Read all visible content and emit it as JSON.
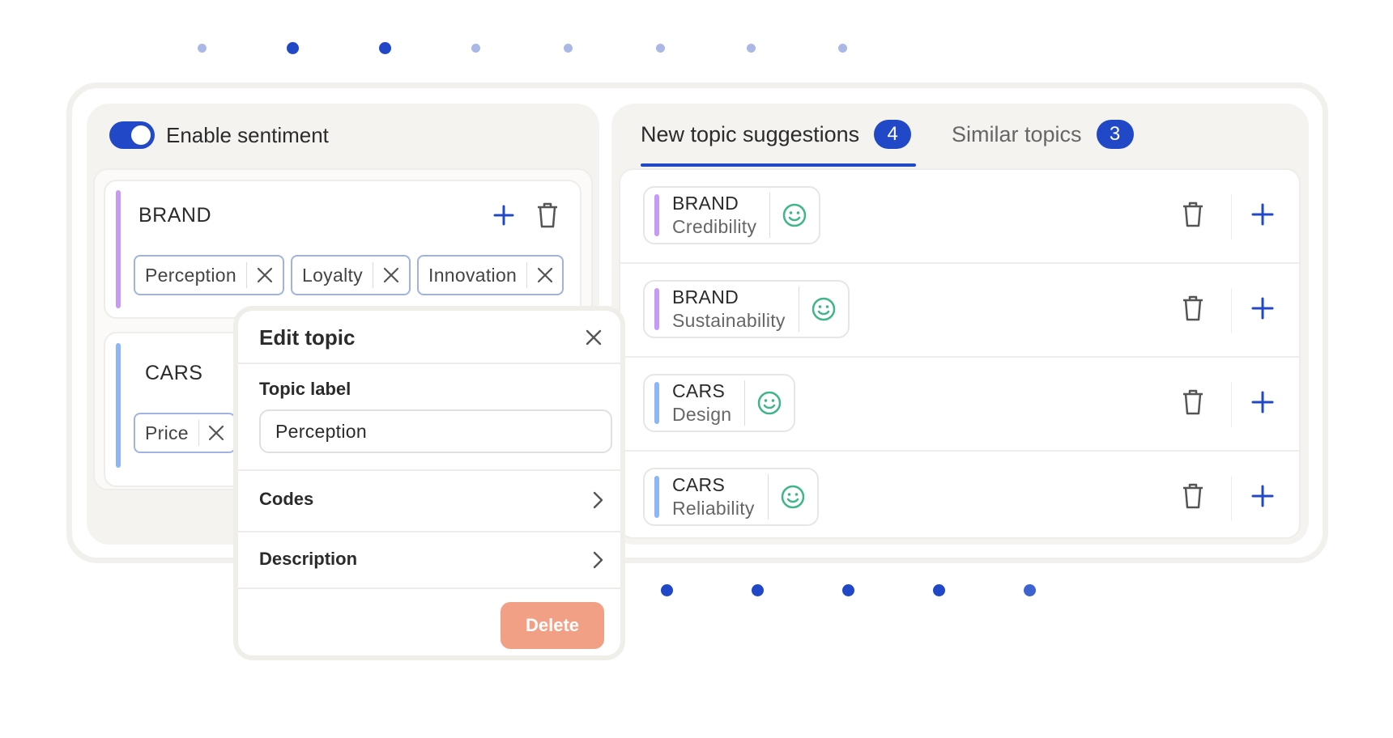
{
  "colors": {
    "accent": "#2148c6",
    "brand_bar": "#c79af5",
    "cars_bar": "#8cb6f5",
    "smile": "#3fb58b",
    "delete_button": "#f2a085"
  },
  "sentiment": {
    "label": "Enable sentiment",
    "enabled": true
  },
  "topics": [
    {
      "name": "BRAND",
      "codes": [
        "Perception",
        "Loyalty",
        "Innovation"
      ]
    },
    {
      "name": "CARS",
      "codes": [
        "Price"
      ]
    }
  ],
  "edit_modal": {
    "title": "Edit topic",
    "topic_label_heading": "Topic label",
    "topic_label_value": "Perception",
    "codes_label": "Codes",
    "description_label": "Description",
    "delete_label": "Delete"
  },
  "tabs": [
    {
      "label": "New topic suggestions",
      "count": "4",
      "active": true
    },
    {
      "label": "Similar topics",
      "count": "3",
      "active": false
    }
  ],
  "suggestions": [
    {
      "category": "BRAND",
      "topic": "Credibility",
      "icon": "smile-icon"
    },
    {
      "category": "BRAND",
      "topic": "Sustainability",
      "icon": "smile-icon"
    },
    {
      "category": "CARS",
      "topic": "Design",
      "icon": "smile-icon"
    },
    {
      "category": "CARS",
      "topic": "Reliability",
      "icon": "smile-icon"
    }
  ],
  "pagination_top": {
    "total": 8,
    "active": [
      1,
      2
    ]
  },
  "pagination_bottom": {
    "total": 5
  }
}
